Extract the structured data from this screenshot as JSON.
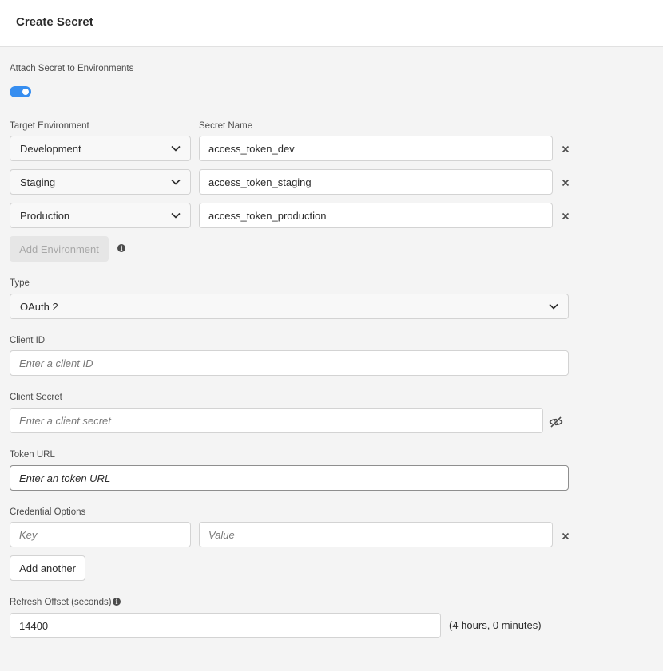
{
  "header": {
    "title": "Create Secret"
  },
  "attach": {
    "label": "Attach Secret to Environments",
    "toggle_on": true
  },
  "environments": {
    "target_label": "Target Environment",
    "name_label": "Secret Name",
    "rows": [
      {
        "environment": "Development",
        "secret_name": "access_token_dev"
      },
      {
        "environment": "Staging",
        "secret_name": "access_token_staging"
      },
      {
        "environment": "Production",
        "secret_name": "access_token_production"
      }
    ],
    "add_button": "Add Environment"
  },
  "type": {
    "label": "Type",
    "value": "OAuth 2"
  },
  "client_id": {
    "label": "Client ID",
    "placeholder": "Enter a client ID"
  },
  "client_secret": {
    "label": "Client Secret",
    "placeholder": "Enter a client secret"
  },
  "token_url": {
    "label": "Token URL",
    "placeholder": "Enter an token URL"
  },
  "credential_options": {
    "label": "Credential Options",
    "key_placeholder": "Key",
    "value_placeholder": "Value",
    "add_button": "Add another"
  },
  "refresh_offset": {
    "label": "Refresh Offset (seconds)",
    "value": "14400",
    "hint": "(4 hours, 0 minutes)"
  },
  "colors": {
    "accent": "#378ef0",
    "background": "#f4f4f4"
  },
  "icons": [
    "chevron-down-icon",
    "close-icon",
    "info-icon",
    "eye-hidden-icon"
  ]
}
